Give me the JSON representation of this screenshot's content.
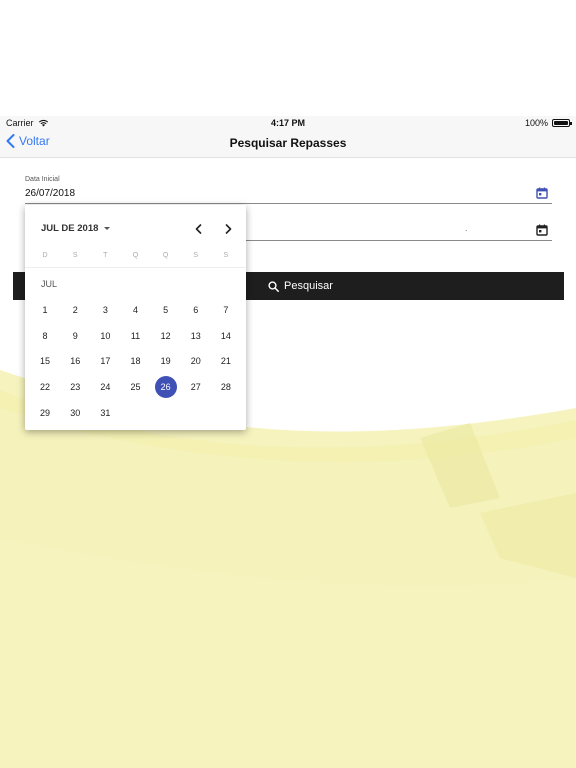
{
  "status_bar": {
    "carrier": "Carrier",
    "time": "4:17 PM",
    "battery": "100%"
  },
  "nav": {
    "back_label": "Voltar",
    "title": "Pesquisar Repasses"
  },
  "form": {
    "start_label": "Data Inicial",
    "start_value": "26/07/2018",
    "end_value": ".",
    "search_label": "Pesquisar"
  },
  "date_picker": {
    "header": "JUL DE 2018",
    "weekdays": [
      "D",
      "S",
      "T",
      "Q",
      "Q",
      "S",
      "S"
    ],
    "month_label": "JUL",
    "first_weekday_offset": 0,
    "days": [
      "1",
      "2",
      "3",
      "4",
      "5",
      "6",
      "7",
      "8",
      "9",
      "10",
      "11",
      "12",
      "13",
      "14",
      "15",
      "16",
      "17",
      "18",
      "19",
      "20",
      "21",
      "22",
      "23",
      "24",
      "25",
      "26",
      "27",
      "28",
      "29",
      "30",
      "31"
    ],
    "selected_day": "26"
  },
  "colors": {
    "accent": "#3f51b5",
    "ios_blue": "#3479f6",
    "button_bg": "#1e1e1e",
    "wave_yellow": "#f3f0b0"
  },
  "icons": {
    "back": "chevron-left-icon",
    "wifi": "wifi-icon",
    "battery": "battery-icon",
    "calendar": "calendar-icon",
    "search": "search-icon",
    "prev": "chevron-left-icon",
    "next": "chevron-right-icon",
    "dropdown": "caret-down-icon"
  }
}
